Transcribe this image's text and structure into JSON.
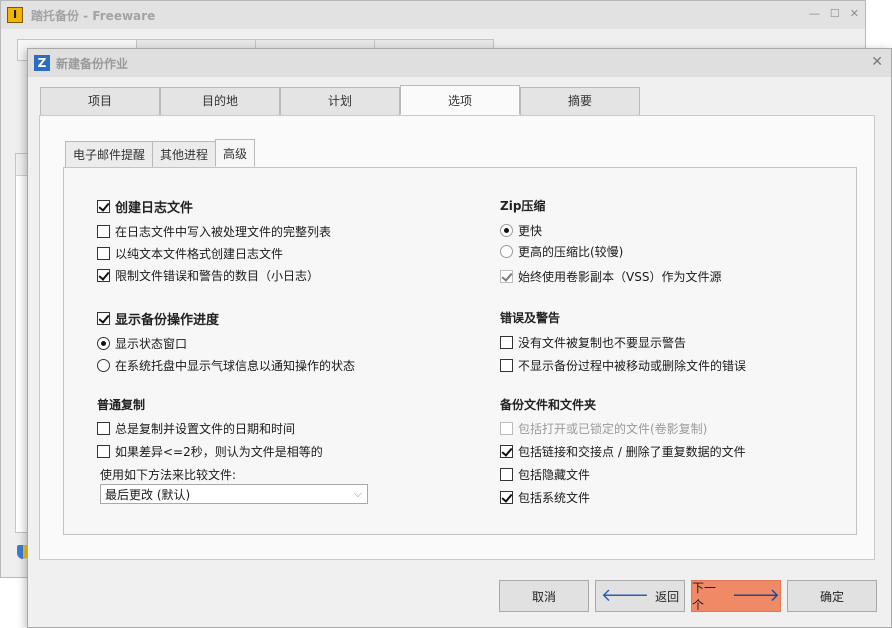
{
  "background_window": {
    "title": "踏托备份 - Freeware",
    "icon_glyph": "I",
    "controls": [
      "—",
      "☐",
      "✕"
    ]
  },
  "dialog": {
    "title": "新建备份作业",
    "icon_glyph": "Z",
    "close_glyph": "✕"
  },
  "main_tabs": [
    "项目",
    "目的地",
    "计划",
    "选项",
    "摘要"
  ],
  "active_main_tab": "选项",
  "sub_tabs": [
    "电子邮件提醒",
    "其他进程",
    "高级"
  ],
  "active_sub_tab": "高级",
  "left": {
    "log": {
      "label": "创建日志文件",
      "checked": true,
      "options": [
        {
          "label": "在日志文件中写入被处理文件的完整列表",
          "checked": false
        },
        {
          "label": "以纯文本文件格式创建日志文件",
          "checked": false
        },
        {
          "label": "限制文件错误和警告的数目（小日志）",
          "checked": true
        }
      ]
    },
    "progress": {
      "label": "显示备份操作进度",
      "checked": true,
      "options": [
        {
          "label": "显示状态窗口",
          "selected": true
        },
        {
          "label": "在系统托盘中显示气球信息以通知操作的状态",
          "selected": false
        }
      ]
    },
    "copy": {
      "heading": "普通复制",
      "options": [
        {
          "label": "总是复制并设置文件的日期和时间",
          "checked": false
        },
        {
          "label": "如果差异<=2秒，则认为文件是相等的",
          "checked": false
        }
      ],
      "compare_label": "使用如下方法来比较文件:",
      "compare_value": "最后更改 (默认)"
    }
  },
  "right": {
    "zip": {
      "heading": "Zip压缩",
      "options": [
        {
          "label": "更快",
          "selected": true
        },
        {
          "label": "更高的压缩比(较慢)",
          "selected": false
        }
      ],
      "vss": {
        "label": "始终使用卷影副本（VSS）作为文件源",
        "checked": true
      }
    },
    "errors": {
      "heading": "错误及警告",
      "options": [
        {
          "label": "没有文件被复制也不要显示警告",
          "checked": false
        },
        {
          "label": "不显示备份过程中被移动或删除文件的错误",
          "checked": false
        }
      ]
    },
    "files": {
      "heading": "备份文件和文件夹",
      "options": [
        {
          "label": "包括打开或已锁定的文件(卷影复制)",
          "checked": false,
          "disabled": true
        },
        {
          "label": "包括链接和交接点 / 删除了重复数据的文件",
          "checked": true,
          "disabled": false
        },
        {
          "label": "包括隐藏文件",
          "checked": false,
          "disabled": false
        },
        {
          "label": "包括系统文件",
          "checked": true,
          "disabled": false
        }
      ]
    }
  },
  "buttons": {
    "cancel": "取消",
    "back": "返回",
    "next": "下一个",
    "ok": "确定"
  },
  "colors": {
    "primary_button": "#f08a66",
    "arrow_icon": "#2a5cb8"
  }
}
